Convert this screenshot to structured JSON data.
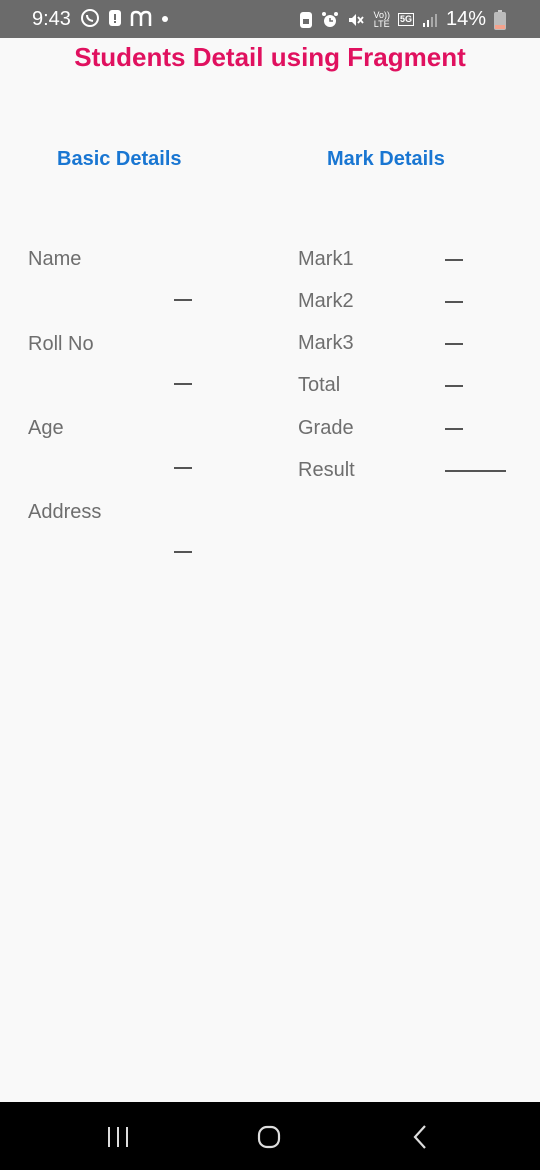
{
  "status_bar": {
    "time": "9:43",
    "battery_percent": "14%",
    "left_icons": [
      "whatsapp-icon",
      "notification-icon",
      "m-app-icon",
      "dot-icon"
    ],
    "right_icons": [
      "sim-icon",
      "alarm-icon",
      "mute-icon",
      "volte-icon",
      "5g-icon",
      "signal-icon",
      "battery-icon"
    ],
    "volte_label": "Vo))",
    "lte_label": "LTE",
    "net_label": "5G"
  },
  "header": {
    "title": "Students Detail using Fragment"
  },
  "basic_details": {
    "heading": "Basic Details",
    "fields": [
      {
        "label": "Name",
        "value": "—"
      },
      {
        "label": "Roll No",
        "value": "—"
      },
      {
        "label": "Age",
        "value": "—"
      },
      {
        "label": "Address",
        "value": "—"
      }
    ]
  },
  "mark_details": {
    "heading": "Mark Details",
    "fields": [
      {
        "label": "Mark1",
        "value": "—"
      },
      {
        "label": "Mark2",
        "value": "—"
      },
      {
        "label": "Mark3",
        "value": "—"
      },
      {
        "label": "Total",
        "value": "—"
      },
      {
        "label": "Grade",
        "value": "—"
      },
      {
        "label": "Result",
        "value": "———"
      }
    ]
  },
  "nav_bar": {
    "icons": [
      "recent-apps-icon",
      "home-icon",
      "back-icon"
    ]
  },
  "colors": {
    "title": "#e0115f",
    "section_heading": "#1976d2",
    "label": "#6e6e6e",
    "background": "#f9f9f9"
  }
}
